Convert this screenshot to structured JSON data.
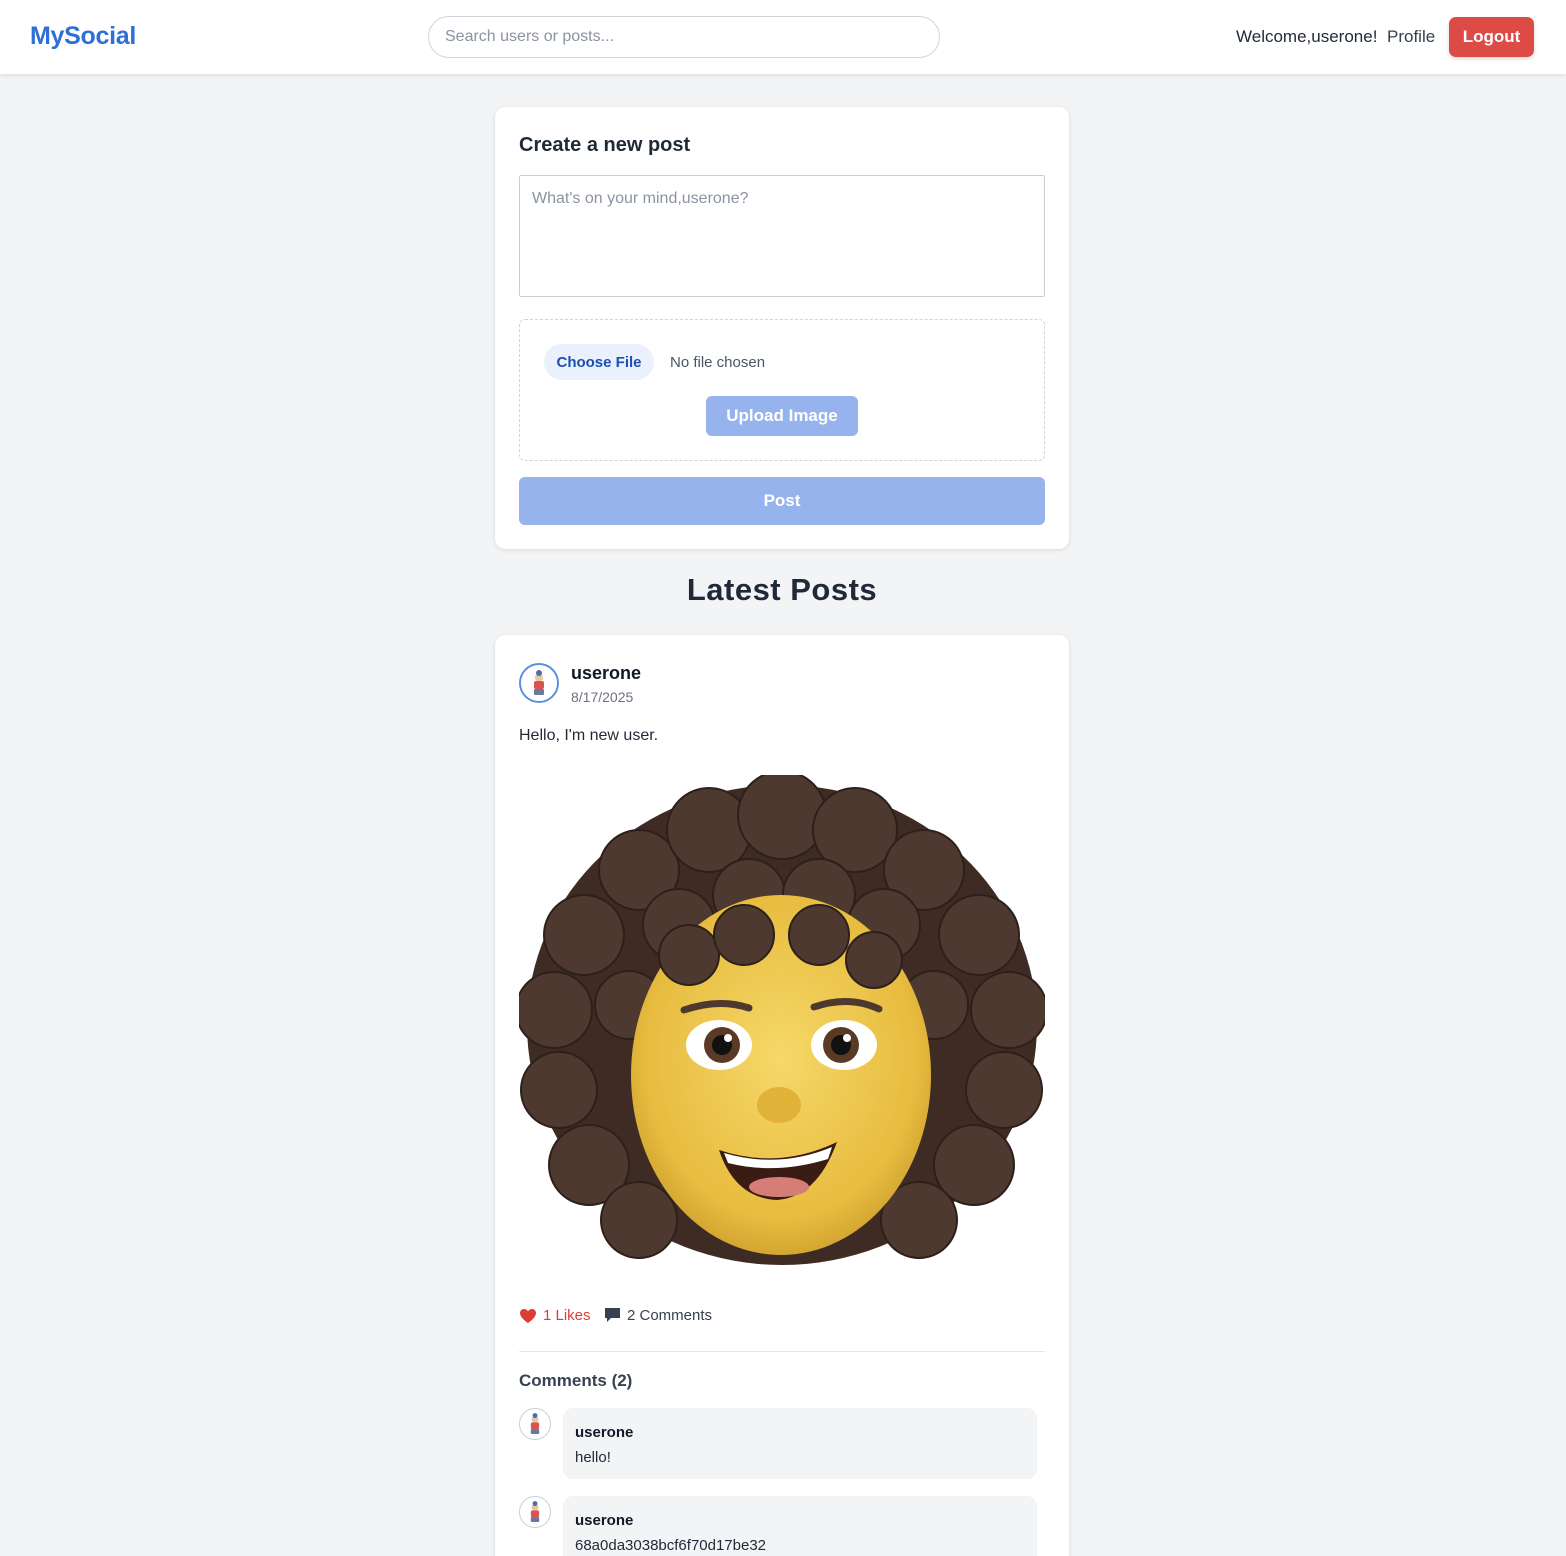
{
  "header": {
    "brand": "MySocial",
    "search_placeholder": "Search users or posts...",
    "welcome": "Welcome,userone!",
    "profile_label": "Profile",
    "logout_label": "Logout"
  },
  "composer": {
    "title": "Create a new post",
    "placeholder": "What's on your mind,userone?",
    "choose_file_label": "Choose File",
    "file_status": "No file chosen",
    "upload_label": "Upload Image",
    "post_label": "Post"
  },
  "feed": {
    "title": "Latest Posts",
    "posts": [
      {
        "author": "userone",
        "date": "8/17/2025",
        "text": "Hello, I'm new user.",
        "likes_label": "1 Likes",
        "comments_label": "2 Comments",
        "comments_title": "Comments (2)",
        "comments": [
          {
            "author": "userone",
            "text": "hello!"
          },
          {
            "author": "userone",
            "text": "68a0da3038bcf6f70d17be32"
          }
        ]
      }
    ]
  },
  "colors": {
    "brand": "#2f6fd6",
    "logout": "#dc4b46",
    "disabled_primary": "#97b3ee",
    "like": "#dc3c34"
  },
  "icons": [
    "search-icon",
    "heart-icon",
    "comment-icon",
    "avatar-icon"
  ]
}
